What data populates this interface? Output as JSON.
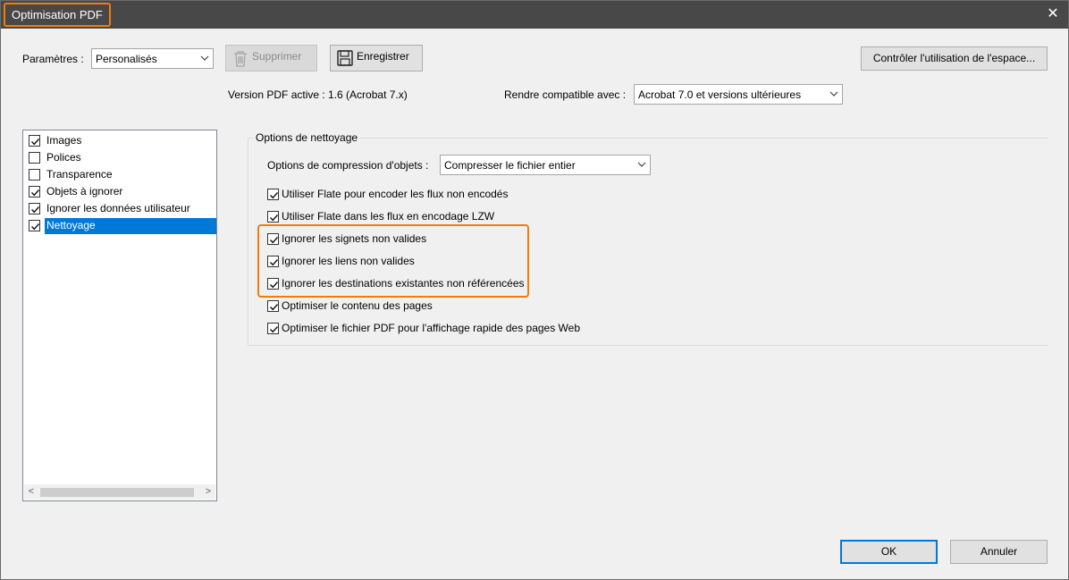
{
  "window": {
    "title": "Optimisation PDF",
    "close_glyph": "✕"
  },
  "params": {
    "label": "Paramètres :",
    "selected": "Personalisés",
    "delete_label": "Supprimer",
    "save_label": "Enregistrer",
    "space_button": "Contrôler l'utilisation de l'espace..."
  },
  "version": {
    "label": "Version PDF active : 1.6 (Acrobat 7.x)",
    "compat_label": "Rendre compatible avec :",
    "compat_selected": "Acrobat 7.0 et versions ultérieures"
  },
  "panels": [
    {
      "label": "Images",
      "checked": true
    },
    {
      "label": "Polices",
      "checked": false
    },
    {
      "label": "Transparence",
      "checked": false
    },
    {
      "label": "Objets à ignorer",
      "checked": true
    },
    {
      "label": "Ignorer les données utilisateur",
      "checked": true
    },
    {
      "label": "Nettoyage",
      "checked": true,
      "selected": true
    }
  ],
  "cleanup": {
    "group_title": "Options de nettoyage",
    "compress_label": "Options de compression d'objets :",
    "compress_selected": "Compresser le fichier entier",
    "options": [
      {
        "label": "Utiliser Flate pour encoder les flux non encodés",
        "checked": true
      },
      {
        "label": "Utiliser Flate dans les flux en encodage LZW",
        "checked": true
      },
      {
        "label": "Ignorer les signets non valides",
        "checked": true
      },
      {
        "label": "Ignorer les liens non valides",
        "checked": true
      },
      {
        "label": "Ignorer les destinations existantes non référencées",
        "checked": true
      },
      {
        "label": "Optimiser le contenu des pages",
        "checked": true
      },
      {
        "label": "Optimiser le fichier PDF pour l'affichage rapide des pages Web",
        "checked": true
      }
    ]
  },
  "footer": {
    "ok": "OK",
    "cancel": "Annuler"
  },
  "colors": {
    "highlight": "#f07c0a",
    "selection": "#0078d7",
    "titlebar": "#484848"
  },
  "icons": {
    "delete": "trash-icon",
    "save": "floppy-disk-icon",
    "close": "close-icon",
    "dropdown": "chevron-down-icon"
  }
}
